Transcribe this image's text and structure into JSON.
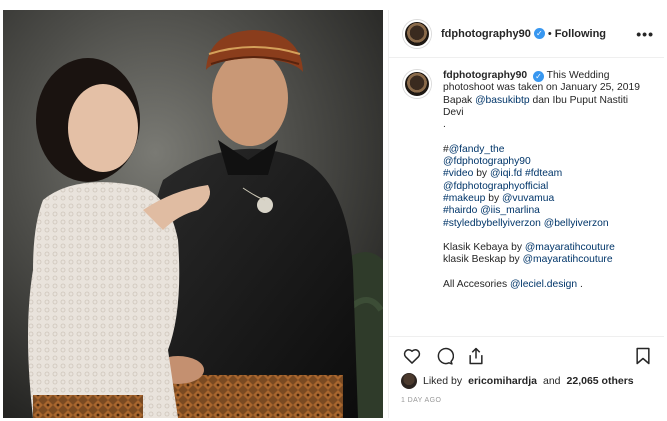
{
  "post": {
    "username": "fdphotography90",
    "verified_mark": "✓",
    "separator": "•",
    "follow_status": "Following",
    "more_label": "•••"
  },
  "caption": {
    "username": "fdphotography90",
    "lines": [
      {
        "text": "This Wedding photoshoot was taken on January 25, 2019",
        "kind": "plain"
      },
      {
        "pre": "Bapak ",
        "link": "@basukibtp",
        "post": " dan Ibu Puput Nastiti Devi",
        "kind": "mixed"
      },
      {
        "text": ".",
        "kind": "plain"
      },
      {
        "text": "",
        "kind": "gap"
      },
      {
        "pre": "#",
        "link": "@fandy_the",
        "post": "",
        "kind": "mixed"
      },
      {
        "text": "@fdphotography90",
        "kind": "link"
      },
      {
        "pre": "",
        "link": "#video",
        "mid": " by ",
        "link2": "@iqi.fd",
        "mid2": " ",
        "link3": "#fdteam",
        "kind": "multi"
      },
      {
        "text": "@fdphotographyofficial",
        "kind": "link"
      },
      {
        "pre": "",
        "link": "#makeup",
        "mid": " by ",
        "link2": "@vuvamua",
        "kind": "multi"
      },
      {
        "pre": "",
        "link": "#hairdo",
        "mid": " ",
        "link2": "@iis_marlina",
        "kind": "multi"
      },
      {
        "pre": "",
        "link": "#styledbybellyiverzon",
        "mid": " ",
        "link2": "@bellyiverzon",
        "kind": "multi"
      },
      {
        "text": "",
        "kind": "gap"
      },
      {
        "pre": "Klasik Kebaya by ",
        "link": "@mayaratihcouture",
        "post": "",
        "kind": "mixed"
      },
      {
        "pre": "klasik Beskap by ",
        "link": "@mayaratihcouture",
        "post": "",
        "kind": "mixed"
      },
      {
        "text": "",
        "kind": "gap"
      },
      {
        "pre": "All Accesories ",
        "link": "@leciel.design",
        "post": " .",
        "kind": "mixed"
      }
    ]
  },
  "actions": {
    "like_icon": "heart-icon",
    "comment_icon": "comment-icon",
    "share_icon": "share-icon",
    "save_icon": "bookmark-icon"
  },
  "likes": {
    "prefix": "Liked by",
    "user": "ericomihardja",
    "conj": "and",
    "count": "22,065 others"
  },
  "timestamp": "1 DAY AGO",
  "colors": {
    "link": "#003569",
    "text": "#262626",
    "verified": "#3897f0",
    "muted": "#999999"
  }
}
